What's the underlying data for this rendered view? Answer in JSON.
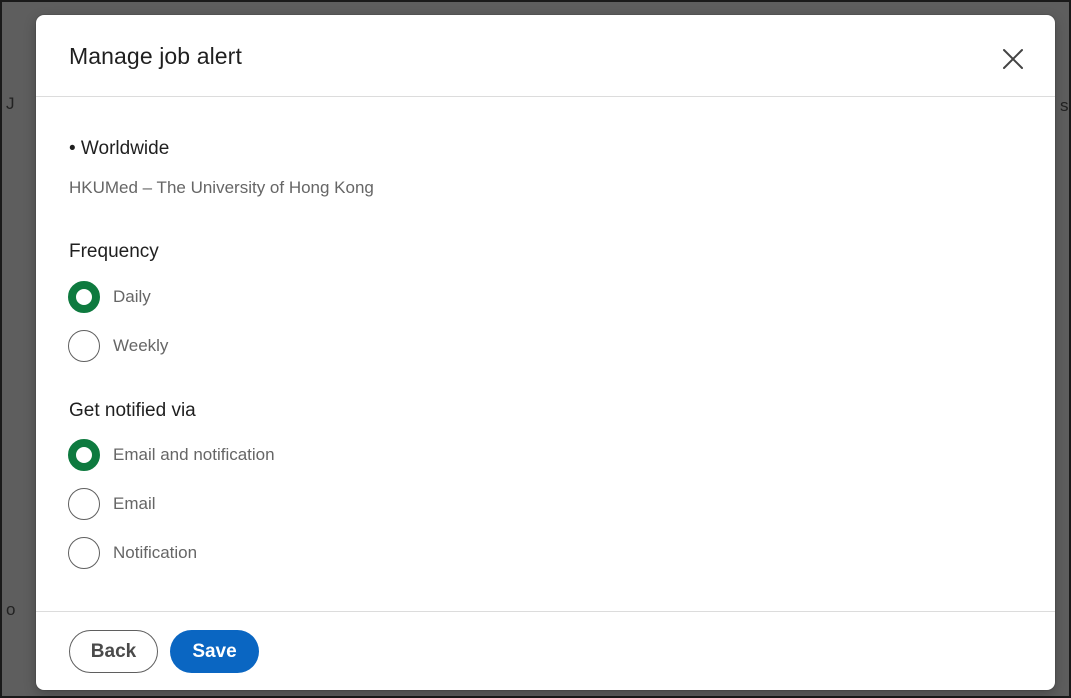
{
  "modal": {
    "title": "Manage job alert",
    "close_icon": "close-icon"
  },
  "alert": {
    "location": "• Worldwide",
    "company": "HKUMed – The University of Hong Kong"
  },
  "frequency": {
    "label": "Frequency",
    "options": [
      {
        "label": "Daily",
        "selected": true
      },
      {
        "label": "Weekly",
        "selected": false
      }
    ]
  },
  "notify": {
    "label": "Get notified via",
    "options": [
      {
        "label": "Email and notification",
        "selected": true
      },
      {
        "label": "Email",
        "selected": false
      },
      {
        "label": "Notification",
        "selected": false
      }
    ]
  },
  "footer": {
    "back_label": "Back",
    "save_label": "Save"
  },
  "colors": {
    "accent_green": "#0e7a3f",
    "primary_blue": "#0a66c2"
  }
}
